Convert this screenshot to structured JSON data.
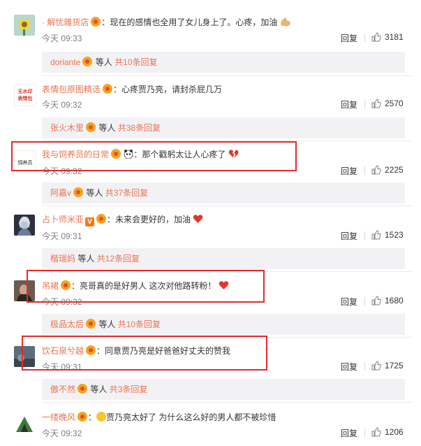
{
  "ui": {
    "reply_label": "回复",
    "today_prefix": "今天",
    "etc_label": "等人",
    "total_prefix": "共",
    "total_suffix": "条回复",
    "colon": "："
  },
  "comments": [
    {
      "username": "· 解忧雜货店",
      "text": "现在的感情也全用了女儿身上了。心疼，加油",
      "time": "09:33",
      "likes": "3181",
      "replies_by": "doriante",
      "reply_count": "10"
    },
    {
      "username": "表情包原图精选",
      "avatar_text": "无水印表情包",
      "text": "心疼贾乃亮，请封杀屁几万",
      "time": "09:32",
      "likes": "2570",
      "replies_by": "张火木里",
      "reply_count": "38"
    },
    {
      "username": "我与饲养员的日常",
      "avatar_text": "饲养员",
      "text": "那个戳躬太让人心疼了",
      "time": "09:32",
      "likes": "2225",
      "replies_by": "阿嘉v",
      "reply_count": "37"
    },
    {
      "username": "占卜师米亚",
      "vip_badge": "V",
      "text": "未来会更好的，加油",
      "time": "09:31",
      "likes": "1523",
      "replies_by": "楷瑞妈",
      "reply_count": "12"
    },
    {
      "username": "吊裙",
      "text": "亮哥真的是好男人 这次对他路转粉！",
      "time": "09:32",
      "likes": "1680",
      "replies_by": "极品太后",
      "reply_count": "10"
    },
    {
      "username": "饮石泉兮越",
      "text": "同意贾乃亮是好爸爸好丈夫的赞我",
      "time": "09:31",
      "likes": "1725",
      "replies_by": "傲不然",
      "reply_count": "3"
    },
    {
      "username": "一缕晚风",
      "text": "贾乃亮太好了 为什么这么好的男人都不被珍惜",
      "time": "09:32",
      "likes": "1206"
    }
  ],
  "colors": {
    "username": "#eb7350",
    "highlight_box": "#e62a2a",
    "subreply_bg": "#f2f2f5"
  }
}
